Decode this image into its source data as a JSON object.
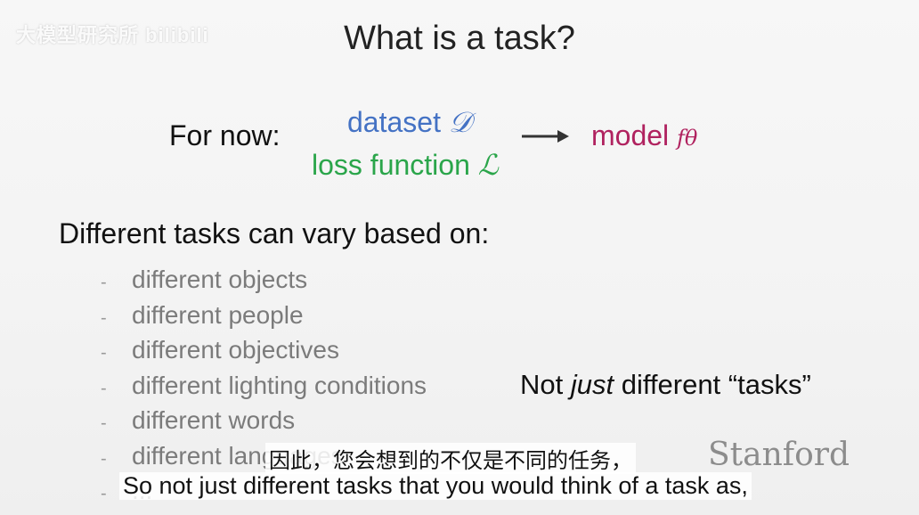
{
  "watermark": "大模型研究所  bilibili",
  "slide": {
    "title": "What is a task?",
    "for_now_label": "For now:",
    "dataset_label": "dataset",
    "dataset_symbol": "𝒟",
    "loss_label": "loss function",
    "loss_symbol": "ℒ",
    "model_label": "model",
    "model_symbol": "fθ",
    "vary_heading": "Different tasks can vary based on:",
    "items": [
      "different objects",
      "different people",
      "different objectives",
      "different lighting conditions",
      "different words",
      "different languages",
      "..."
    ],
    "not_just_prefix": "Not ",
    "not_just_emphasis": "just",
    "not_just_suffix": " different “tasks”",
    "logo": "Stanford"
  },
  "subtitles": {
    "chinese": "因此，您会想到的不仅是不同的任务，",
    "english": "So not just different tasks that you would think of a task as,"
  },
  "colors": {
    "dataset": "#4472c4",
    "loss": "#2aa54a",
    "model": "#b0225f"
  }
}
